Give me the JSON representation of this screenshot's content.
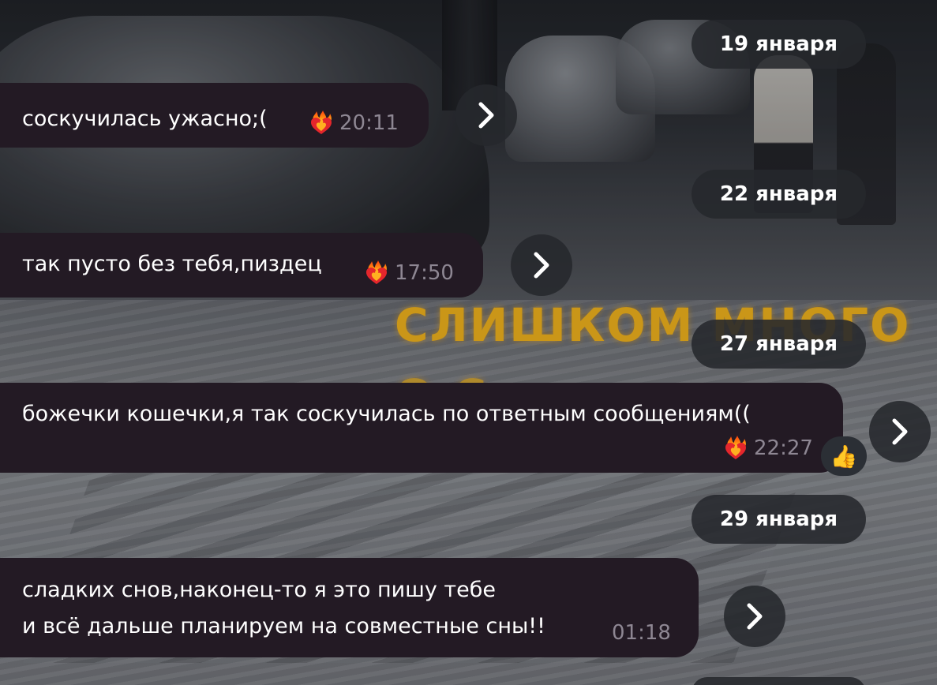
{
  "wallpaper": {
    "caption_line1": "СЛИШКОМ МНОГО",
    "caption_line2": "О С"
  },
  "dates": [
    {
      "label": "19 января"
    },
    {
      "label": "22 января"
    },
    {
      "label": "27 января"
    },
    {
      "label": "29 января"
    }
  ],
  "messages": [
    {
      "text": "соскучилась ужасно;(",
      "time": "20:11",
      "reaction": "heart-on-fire-icon"
    },
    {
      "text": "так пусто без тебя,пиздец",
      "time": "17:50",
      "reaction": "heart-on-fire-icon"
    },
    {
      "text": "божечки кошечки,я так соскучилась по ответным сообщениям((",
      "time": "22:27",
      "reaction": "heart-on-fire-icon",
      "extra_reaction": "👍"
    },
    {
      "text_line1": "сладких снов,наконец-то я это пишу тебе",
      "text_line2": "и всё дальше планируем на совместные сны!!",
      "time": "01:18"
    }
  ],
  "colors": {
    "bubble": "#231a24",
    "pill": "#26282c",
    "time": "#8e8793",
    "accent_caption": "#f4b51a"
  }
}
